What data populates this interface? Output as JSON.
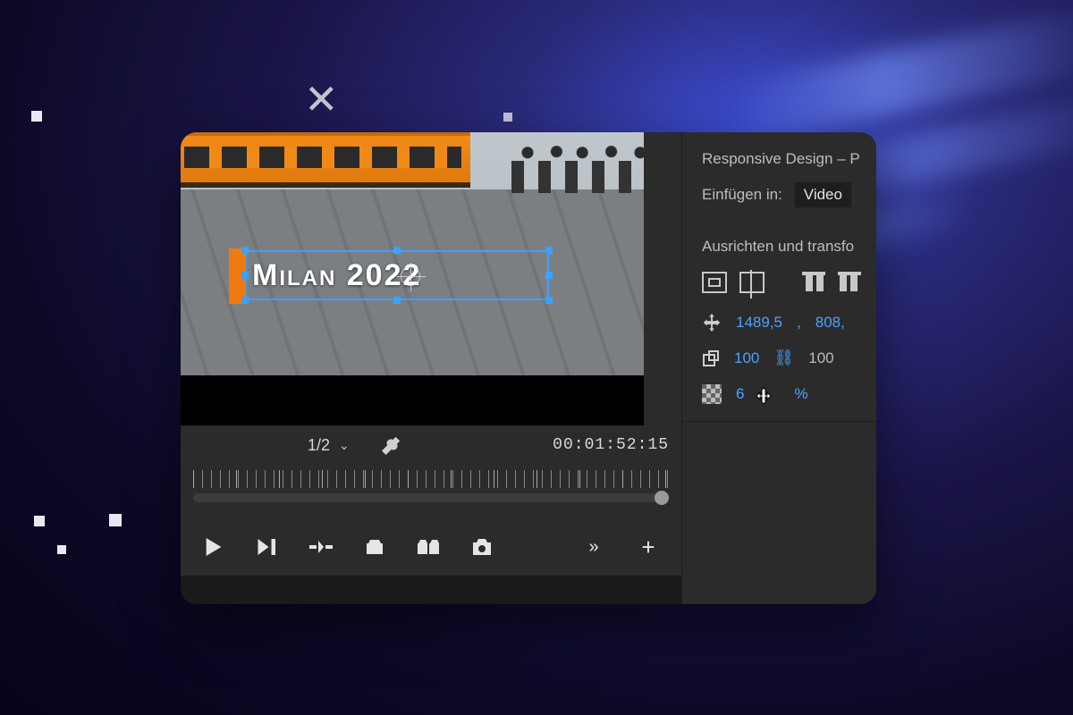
{
  "overlay": {
    "close_glyph": "✕"
  },
  "preview": {
    "title_text": "Milan 2022",
    "zoom": "1/2",
    "timecode": "00:01:52:15"
  },
  "transport": {
    "play": "▶",
    "step": "⏵",
    "more": "»",
    "add": "+"
  },
  "props": {
    "section_responsive": "Responsive Design – P",
    "insert_label": "Einfügen in:",
    "insert_value": "Video",
    "section_align": "Ausrichten und transfo",
    "position_x": "1489,5",
    "position_sep": ",",
    "position_y": "808,",
    "scale": "100",
    "scale_linked": "100",
    "opacity_value": "6",
    "opacity_unit": "%"
  }
}
